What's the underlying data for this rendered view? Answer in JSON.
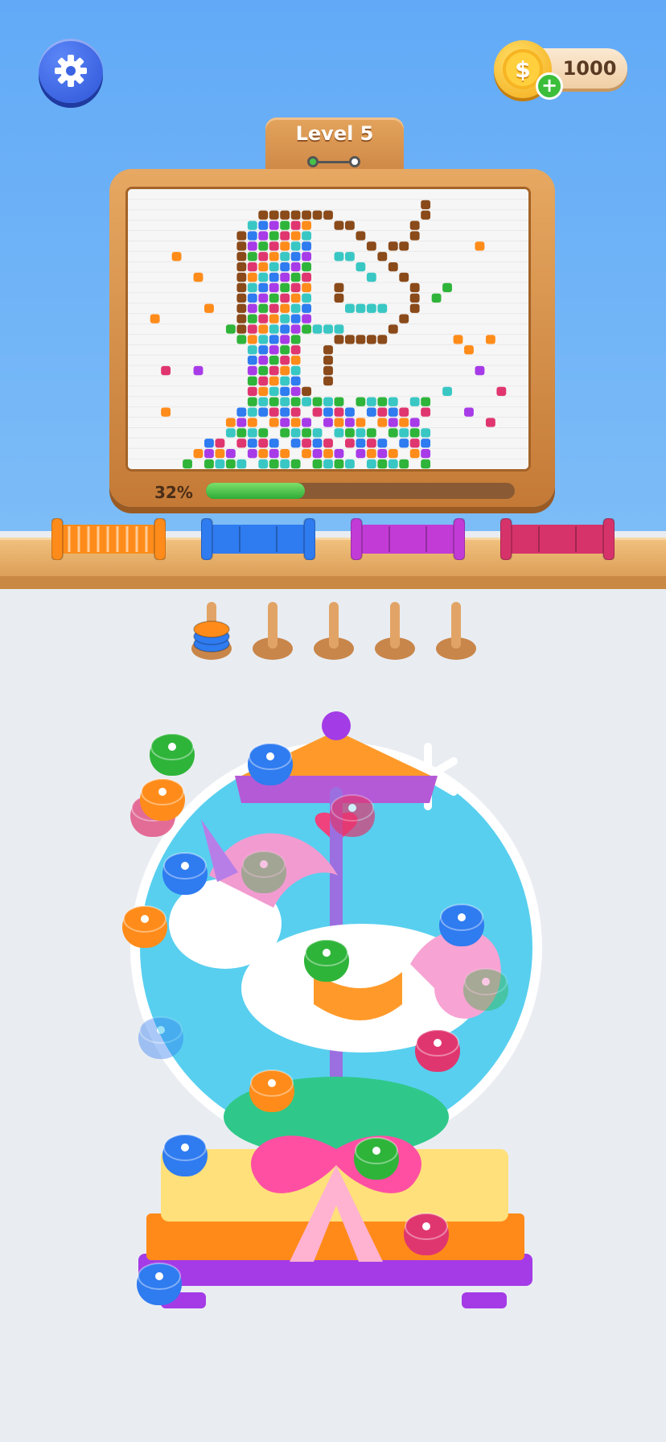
{
  "header": {
    "settings_icon": "gear-icon",
    "coins": {
      "amount": "1000",
      "coin_symbol": "$",
      "add_symbol": "+"
    }
  },
  "level": {
    "label": "Level 5",
    "steps_total": 2,
    "steps_done": 1
  },
  "progress": {
    "label": "32%",
    "value": 0.32
  },
  "spools": [
    {
      "color_name": "orange",
      "color": "#ff8c1a",
      "filled": true
    },
    {
      "color_name": "blue",
      "color": "#2f7bf0",
      "filled": false
    },
    {
      "color_name": "purple",
      "color": "#c23bd6",
      "filled": false
    },
    {
      "color_name": "pink",
      "color": "#d6336b",
      "filled": false
    }
  ],
  "pegs": [
    {
      "yarn_stack": [
        "#2f7bf0",
        "#2f7bf0",
        "#ff8c1a"
      ]
    },
    {
      "yarn_stack": []
    },
    {
      "yarn_stack": []
    },
    {
      "yarn_stack": []
    },
    {
      "yarn_stack": []
    }
  ],
  "colors": {
    "orange": "#ff8c1a",
    "blue": "#2f7bf0",
    "green": "#2fb43a",
    "pink": "#e03670",
    "purple": "#a83be8",
    "brown": "#8a4a1a",
    "teal": "#39c7c4"
  }
}
